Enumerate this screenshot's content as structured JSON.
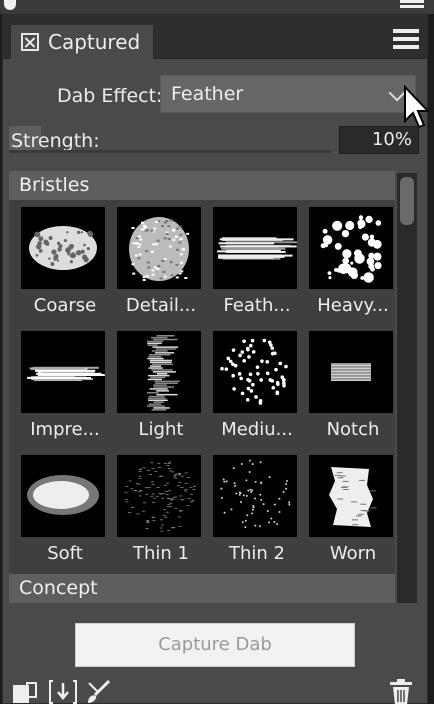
{
  "panel": {
    "tab_label": "Captured",
    "tab_close_icon": "close-box-icon",
    "menu_icon": "hamburger-menu-icon"
  },
  "controls": {
    "dab_effect_label": "Dab Effect:",
    "dab_effect_value": "Feather",
    "strength_label": "Strength:",
    "strength_value": "10%",
    "strength_fraction": 0.1
  },
  "groups": [
    {
      "title": "Bristles",
      "items": [
        {
          "label": "Coarse",
          "icon": "coarse-dab"
        },
        {
          "label": "Detail...",
          "icon": "detail-dab"
        },
        {
          "label": "Feath...",
          "icon": "feather-dab"
        },
        {
          "label": "Heavy...",
          "icon": "heavy-dab"
        },
        {
          "label": "Impre...",
          "icon": "impressionist-dab"
        },
        {
          "label": "Light",
          "icon": "light-dab"
        },
        {
          "label": "Mediu...",
          "icon": "medium-dab"
        },
        {
          "label": "Notch",
          "icon": "notch-dab"
        },
        {
          "label": "Soft",
          "icon": "soft-dab"
        },
        {
          "label": "Thin 1",
          "icon": "thin1-dab"
        },
        {
          "label": "Thin 2",
          "icon": "thin2-dab"
        },
        {
          "label": "Worn",
          "icon": "worn-dab"
        }
      ]
    },
    {
      "title": "Concept",
      "items": []
    }
  ],
  "actions": {
    "capture_label": "Capture Dab"
  },
  "footer_icons": [
    "new-variant-icon",
    "import-icon",
    "brush-settings-icon",
    "trash-icon"
  ],
  "colors": {
    "panel_bg": "#4a4a4a",
    "header_bg": "#5e5e5e",
    "thumb_bg": "#000000"
  }
}
